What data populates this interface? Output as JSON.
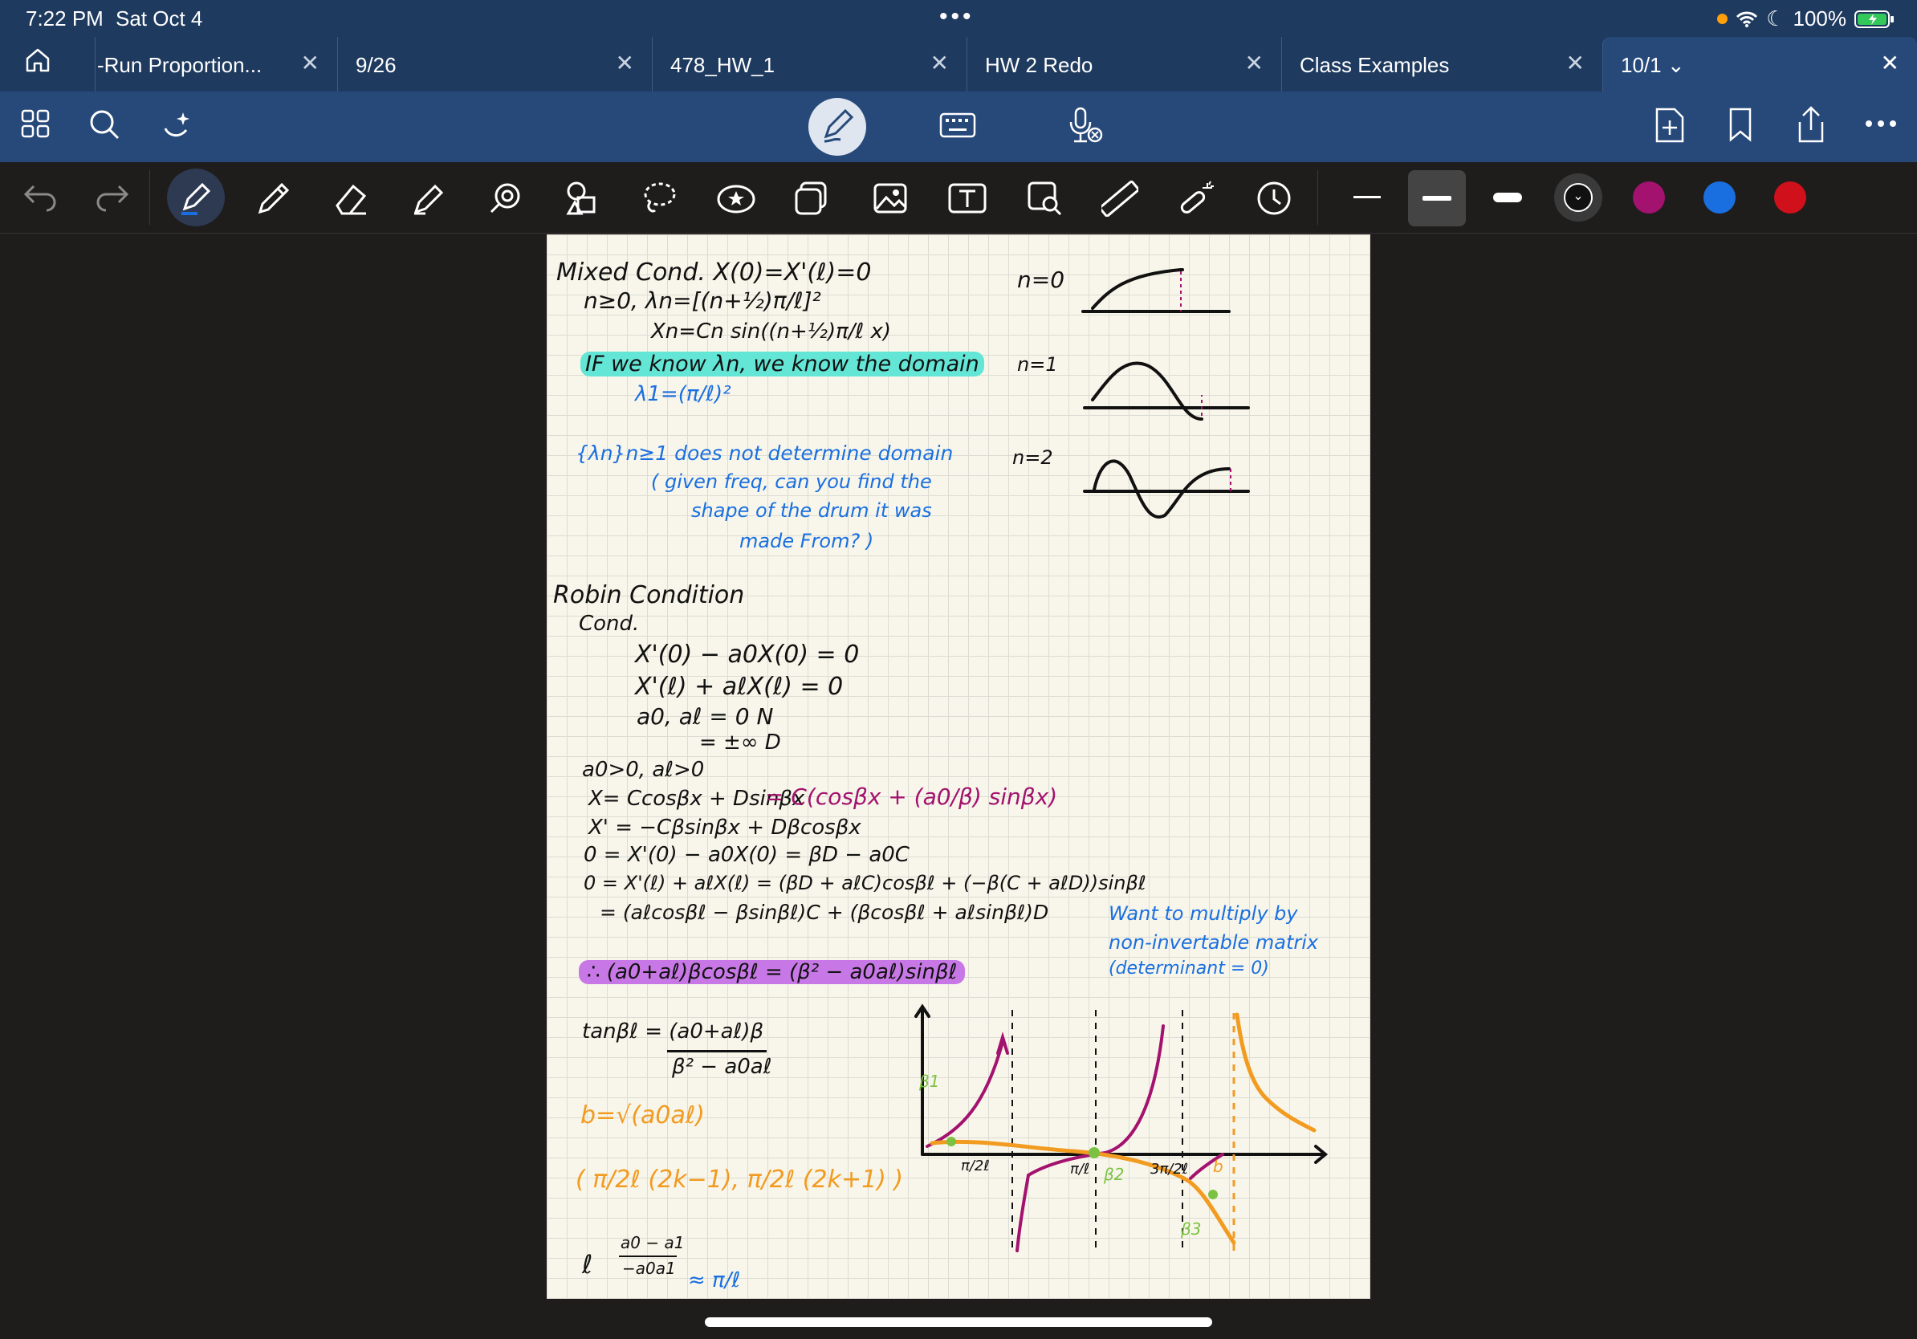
{
  "status": {
    "time": "7:22 PM",
    "date": "Sat Oct 4",
    "battery": "100%"
  },
  "tabs": [
    {
      "label": "-Run Proportion..."
    },
    {
      "label": "9/26"
    },
    {
      "label": "478_HW_1"
    },
    {
      "label": "HW 2 Redo"
    },
    {
      "label": "Class Examples"
    },
    {
      "label": "10/1 ⌄"
    }
  ],
  "colors": {
    "accent": "#1e3a5f",
    "palette": [
      "#111111",
      "#a3126e",
      "#1a6fe0",
      "#d0101a"
    ]
  },
  "notes": {
    "mixed_title": "Mixed Cond. X(0)=X'(ℓ)=0",
    "mixed_n": "n≥0, λn=[(n+½)π/ℓ]²",
    "mixed_xn": "Xn=Cn sin((n+½)π/ℓ x)",
    "if_know": "IF we know λn, we know the domain",
    "lambda1": "λ1=(π/ℓ)²",
    "lambda_set": "{λn}n≥1 does not determine domain",
    "given_freq": "( given freq, can you find the",
    "shape_drum": "shape of the drum it was",
    "made_from": "made From? )",
    "graph_n0": "n=0",
    "graph_n1": "n=1",
    "graph_n2": "n=2",
    "robin_title": "Robin Condition",
    "robin_cond": "Cond.",
    "robin_eq1": "X'(0) − a0X(0) = 0",
    "robin_eq2": "X'(ℓ) + aℓX(ℓ) = 0",
    "robin_eq3": "a0, aℓ = 0  N",
    "robin_eq4": "= ±∞  D",
    "robin_pos": "a0>0, aℓ>0",
    "robin_x": "X= Ccosβx + Dsinβx",
    "robin_x_mag": "= C(cosβx + (a0/β) sinβx)",
    "robin_xprime": "X' = −Cβsinβx + Dβcosβx",
    "robin_0eq": "0 = X'(0) − a0X(0) = βD − a0C",
    "robin_0eq2": "0 = X'(ℓ) + aℓX(ℓ) = (βD + aℓC)cosβℓ + (−β(C + aℓD))sinβℓ",
    "robin_0eq3": "= (aℓcosβℓ − βsinβℓ)C + (βcosβℓ + aℓsinβℓ)D",
    "want": "Want to multiply by",
    "noninv": "non-invertable matrix",
    "determinant": "(determinant = 0)",
    "therefore": "∴ (a0+aℓ)βcosβℓ = (β² − a0aℓ)sinβℓ",
    "tan_num": "tanβℓ = (a0+aℓ)β",
    "tan_den": "β² − a0aℓ",
    "b_def": "b=√(a0aℓ)",
    "interval": "( π/2ℓ (2k−1), π/2ℓ (2k+1) )",
    "ell": "ℓ",
    "frac_num": "a0 − a1",
    "frac_den": "−a0a1",
    "approx": "≈ π/ℓ",
    "g_tick1": "π/2ℓ",
    "g_tick2": "π/ℓ",
    "g_tick3": "3π/2ℓ",
    "g_beta1": "β1",
    "g_beta2": "β2",
    "g_beta3": "β3",
    "g_b": "b"
  }
}
